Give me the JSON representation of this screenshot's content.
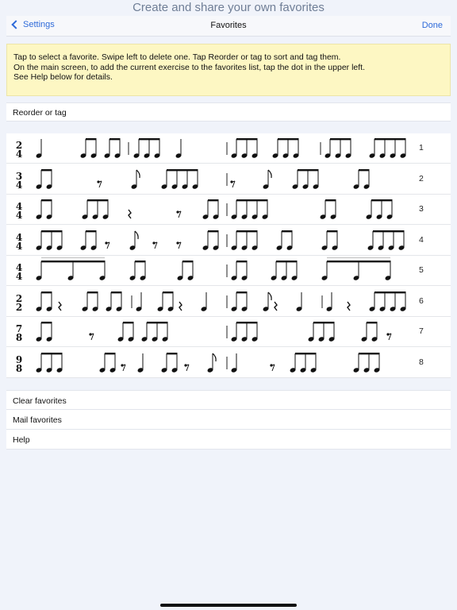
{
  "banner": "Create and share your own favorites",
  "navbar": {
    "back_label": "Settings",
    "title": "Favorites",
    "done_label": "Done"
  },
  "info": {
    "lines": [
      "Tap to select a favorite. Swipe left to delete one. Tap Reorder or tag to sort and tag them.",
      "On the main screen, to add the current exercise to the favorites list, tap the dot in the upper left.",
      "See Help below for details."
    ]
  },
  "reorder_label": "Reorder or tag",
  "favorites": [
    {
      "time_sig": [
        "2",
        "4"
      ],
      "number": "1"
    },
    {
      "time_sig": [
        "3",
        "4"
      ],
      "number": "2"
    },
    {
      "time_sig": [
        "4",
        "4"
      ],
      "number": "3"
    },
    {
      "time_sig": [
        "4",
        "4"
      ],
      "number": "4"
    },
    {
      "time_sig": [
        "4",
        "4"
      ],
      "number": "5"
    },
    {
      "time_sig": [
        "2",
        "2"
      ],
      "number": "6"
    },
    {
      "time_sig": [
        "7",
        "8"
      ],
      "number": "7"
    },
    {
      "time_sig": [
        "9",
        "8"
      ],
      "number": "8"
    }
  ],
  "actions": {
    "clear": "Clear favorites",
    "mail": "Mail favorites",
    "help": "Help"
  },
  "colors": {
    "accent": "#2e6ad9",
    "note_bg": "#fdf7c3",
    "page_bg": "#f0f3fa"
  }
}
